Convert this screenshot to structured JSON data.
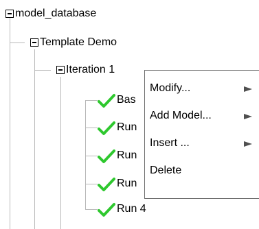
{
  "tree": {
    "root": {
      "label": "model_database",
      "expanded": true
    },
    "project": {
      "label": "Template Demo",
      "expanded": true
    },
    "iteration": {
      "label": "Iteration 1",
      "expanded": true
    },
    "runs": [
      {
        "label": "Bas",
        "status_icon": "check-icon"
      },
      {
        "label": "Run",
        "status_icon": "check-icon"
      },
      {
        "label": "Run",
        "status_icon": "check-icon"
      },
      {
        "label": "Run",
        "status_icon": "check-icon"
      },
      {
        "label": "Run 4",
        "status_icon": "check-icon"
      }
    ]
  },
  "context_menu": {
    "items": [
      {
        "label": "Modify...",
        "has_submenu": true
      },
      {
        "label": "Add Model...",
        "has_submenu": true
      },
      {
        "label": "Insert ...",
        "has_submenu": true
      },
      {
        "label": "Delete",
        "has_submenu": false
      }
    ]
  },
  "colors": {
    "check": "#2ec82e",
    "tree_line": "#b8b8b8",
    "menu_border": "#6e6e6e",
    "submenu_arrow": "#505050"
  }
}
